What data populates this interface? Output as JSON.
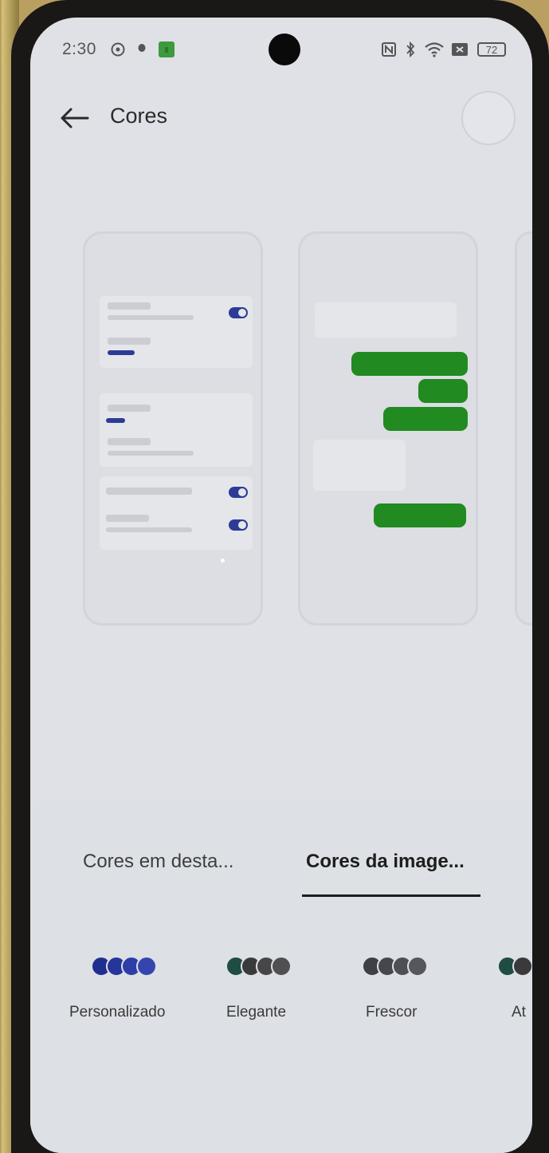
{
  "status_bar": {
    "time": "2:30",
    "battery": "72"
  },
  "header": {
    "title": "Cores"
  },
  "tabs": [
    {
      "label": "Cores em desta...",
      "active": false
    },
    {
      "label": "Cores da image...",
      "active": true
    }
  ],
  "palettes": [
    {
      "label": "Personalizado",
      "colors": [
        "#1f2f8f",
        "#26359a",
        "#2e3ea6",
        "#3545b0"
      ]
    },
    {
      "label": "Elegante",
      "colors": [
        "#1f4c45",
        "#3a3a3a",
        "#464646",
        "#505050"
      ]
    },
    {
      "label": "Frescor",
      "colors": [
        "#3e4046",
        "#45474d",
        "#4d4f55",
        "#55575c"
      ]
    },
    {
      "label": "At",
      "colors": [
        "#1f4c45",
        "#3a3a3a"
      ]
    }
  ],
  "colors": {
    "accent": "#2d3b96",
    "bubble": "#218a21"
  }
}
